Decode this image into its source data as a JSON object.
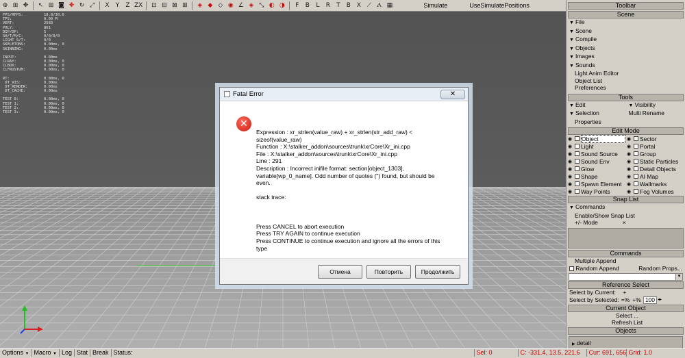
{
  "toolbar": {
    "axis_buttons": [
      "X",
      "Y",
      "Z",
      "ZX"
    ],
    "snap_letters": [
      "F",
      "B",
      "L",
      "R",
      "T",
      "B",
      "X"
    ],
    "simulate_label": "Simulate",
    "use_simulate_label": "UseSimulatePositions",
    "panel_title": "Toolbar"
  },
  "stats": {
    "group1": [
      [
        "FPS/RFPS:",
        "18.8/30.0"
      ],
      [
        "TPS:",
        "0.00 M"
      ],
      [
        "VERT:",
        "2583"
      ],
      [
        "POLY:",
        "861"
      ],
      [
        "DIP/DP:",
        "5"
      ],
      [
        "SH/T/M/C:",
        "0/0/0/0"
      ],
      [
        "LIGHT S/T:",
        "0/0"
      ],
      [
        "SKELETONS:",
        "0.00ms, 0"
      ],
      [
        "SKINNING:",
        "0.00ms"
      ]
    ],
    "group2": [
      [
        "INPUT:",
        "0.00ms"
      ],
      [
        "CLRAY:",
        "0.00ms, 0"
      ],
      [
        "CLBOX:",
        "0.00ms, 0"
      ],
      [
        "CLFRUSTUM:",
        "0.00ms, 0"
      ]
    ],
    "group3": [
      [
        "RT:",
        "0.00ms, 0"
      ],
      [
        " DT_VIS:",
        "0.00ms"
      ],
      [
        " DT_RENDER:",
        "0.00ms"
      ],
      [
        " DT_CACHE:",
        "0.00ms"
      ]
    ],
    "group4": [
      [
        "TEST 0:",
        "0.00ms, 0"
      ],
      [
        "TEST 1:",
        "0.00ms, 0"
      ],
      [
        "TEST 2:",
        "0.00ms, 0"
      ],
      [
        "TEST 3:",
        "0.00ms, 0"
      ]
    ]
  },
  "panel": {
    "scene": {
      "title": "Scene",
      "items": [
        "File",
        "Scene",
        "Compile",
        "Objects",
        "Images",
        "Sounds"
      ],
      "sub_items": [
        "Light Anim Editor",
        "Object List",
        "Preferences"
      ]
    },
    "tools": {
      "title": "Tools",
      "edit": "Edit",
      "visibility": "Visibility",
      "selection": "Selection",
      "multi_rename": "Multi Rename",
      "properties": "Properties"
    },
    "edit_mode": {
      "title": "Edit Mode",
      "rows": [
        [
          "Object",
          "Sector"
        ],
        [
          "Light",
          "Portal"
        ],
        [
          "Sound Source",
          "Group"
        ],
        [
          "Sound Env",
          "Static Particles"
        ],
        [
          "Glow",
          "Detail Objects"
        ],
        [
          "Shape",
          "AI Map"
        ],
        [
          "Spawn Element",
          "Wallmarks"
        ],
        [
          "Way Points",
          "Fog Volumes"
        ]
      ]
    },
    "snap_list": {
      "title": "Snap List",
      "commands": "Commands",
      "enable_show": "Enable/Show Snap List",
      "mode_label": "Mode",
      "mode_prefix": "+/-",
      "mode_close": "×"
    },
    "commands": {
      "title": "Commands",
      "multiple_append": "Multiple Append",
      "random_append": "Random Append",
      "random_props": "Random Props..."
    },
    "reference_select": {
      "title": "Reference Select",
      "select_by_current": "Select by Current:",
      "plus": "+",
      "select_by_selected": "Select by Selected:",
      "eq_pct": "=%",
      "plus_pct": "+%",
      "value": "100"
    },
    "current_object": {
      "title": "Current Object",
      "select": "Select ...",
      "refresh": "Refresh List"
    },
    "objects": {
      "title": "Objects",
      "items": [
        "detail"
      ]
    }
  },
  "dialog": {
    "title": "Fatal Error",
    "close_glyph": "✕",
    "lines": [
      "Expression    : xr_strlen(value_raw) + xr_strlen(str_add_raw) <",
      "sizeof(value_raw)",
      "Function      : X:\\stalker_addon\\sources\\trunk\\xrCore\\Xr_ini.cpp",
      "File          : X:\\stalker_addon\\sources\\trunk\\xrCore\\Xr_ini.cpp",
      "Line          : 291",
      "Description   : Incorrect inifile format: section[object_1303],",
      "variable[wp_0_name]. Odd number of quotes (\") found, but should be",
      "even.",
      "",
      "stack trace:",
      "",
      "",
      "",
      "Press CANCEL to abort execution",
      "Press TRY AGAIN to continue execution",
      "Press CONTINUE to continue execution and ignore all the errors of this",
      "type"
    ],
    "buttons": {
      "cancel": "Отмена",
      "retry": "Повторить",
      "continue": "Продолжить"
    }
  },
  "statusbar": {
    "options": "Options",
    "macro": "Macro",
    "log": "Log",
    "stat": "Stat",
    "break": "Break",
    "status": "Status:",
    "sel": "Sel: 0",
    "coords": "C: -331.4, 13.5, 221.6",
    "cur": "Cur: 691, 656",
    "grid": "Grid: 1.0"
  }
}
